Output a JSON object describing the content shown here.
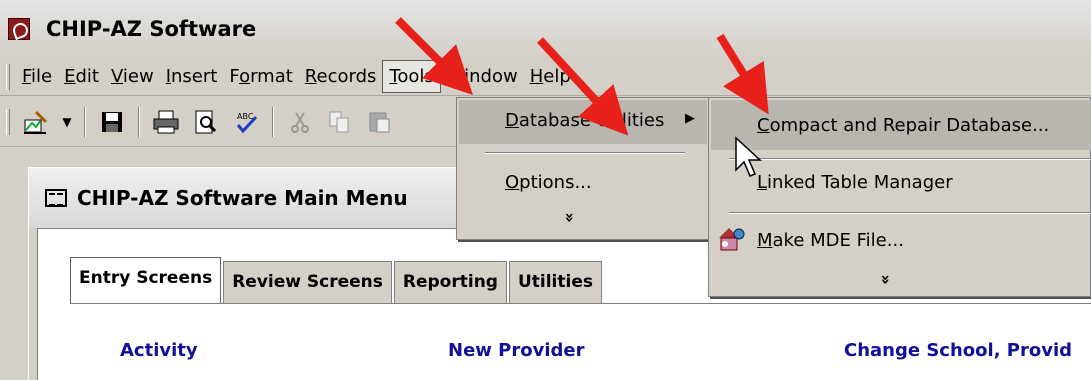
{
  "app": {
    "title": "CHIP-AZ Software"
  },
  "menubar": {
    "items": [
      {
        "label": "File",
        "ul": "F",
        "rest": "ile"
      },
      {
        "label": "Edit",
        "ul": "E",
        "rest": "dit"
      },
      {
        "label": "View",
        "ul": "V",
        "rest": "iew"
      },
      {
        "label": "Insert",
        "ul": "I",
        "rest": "nsert"
      },
      {
        "label": "Format",
        "pre": "F",
        "ul": "o",
        "rest": "rmat"
      },
      {
        "label": "Records",
        "ul": "R",
        "rest": "ecords"
      },
      {
        "label": "Tools",
        "ul": "T",
        "rest": "ools"
      },
      {
        "label": "Window",
        "ul": "W",
        "rest": "indow"
      },
      {
        "label": "Help",
        "ul": "H",
        "rest": "elp"
      }
    ]
  },
  "toolbar": {
    "icons": [
      "design-view-icon",
      "dropdown-arrow-icon",
      "save-icon",
      "print-icon",
      "print-preview-icon",
      "spelling-icon",
      "cut-icon",
      "copy-icon",
      "paste-icon"
    ]
  },
  "tools_menu": {
    "items": [
      {
        "ul": "D",
        "rest": "atabase Utilities",
        "arrow": "▶"
      },
      {
        "ul": "O",
        "rest": "ptions..."
      }
    ],
    "expand": "»"
  },
  "db_utilities_menu": {
    "items": [
      {
        "ul": "C",
        "rest": "ompact and Repair Database..."
      },
      {
        "ul": "L",
        "rest": "inked Table Manager"
      },
      {
        "ul": "M",
        "rest": "ake MDE File..."
      }
    ],
    "expand": "»"
  },
  "main_window": {
    "title": "CHIP-AZ Software Main Menu",
    "tabs": [
      "Entry Screens",
      "Review Screens",
      "Reporting",
      "Utilities"
    ],
    "labels": [
      "Activity",
      "New Provider",
      "Change School, Provid"
    ]
  },
  "colors": {
    "arrow": "#e8201a",
    "label_blue": "#101098",
    "highlight": "#b8b6ae"
  }
}
